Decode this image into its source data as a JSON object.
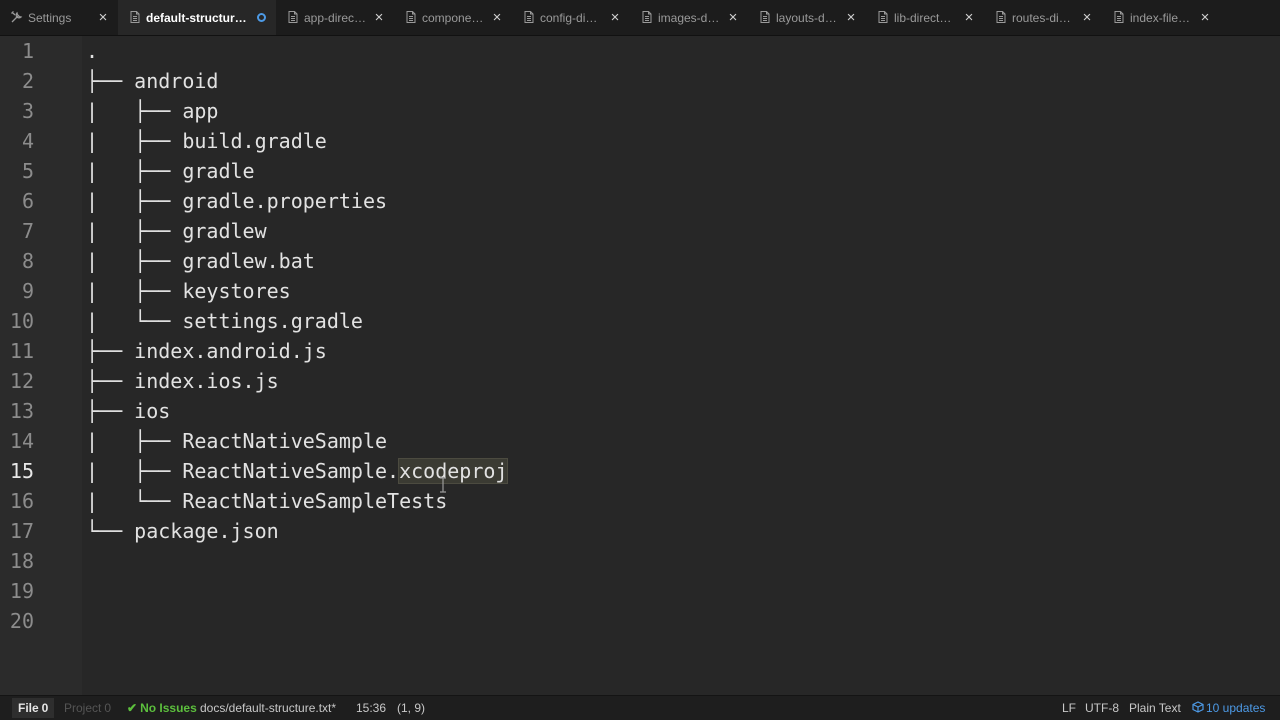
{
  "tabs": [
    {
      "label": "Settings",
      "icon": "settings-icon",
      "active": false,
      "modified": false
    },
    {
      "label": "default-structure.txt",
      "icon": "file-icon",
      "active": true,
      "modified": true
    },
    {
      "label": "app-directory",
      "icon": "file-icon",
      "active": false,
      "modified": false
    },
    {
      "label": "components-directory",
      "icon": "file-icon",
      "active": false,
      "modified": false
    },
    {
      "label": "config-directory",
      "icon": "file-icon",
      "active": false,
      "modified": false
    },
    {
      "label": "images-directory",
      "icon": "file-icon",
      "active": false,
      "modified": false
    },
    {
      "label": "layouts-directory",
      "icon": "file-icon",
      "active": false,
      "modified": false
    },
    {
      "label": "lib-directory",
      "icon": "file-icon",
      "active": false,
      "modified": false
    },
    {
      "label": "routes-directory",
      "icon": "file-icon",
      "active": false,
      "modified": false
    },
    {
      "label": "index-files",
      "icon": "file-icon",
      "active": false,
      "modified": false
    }
  ],
  "tab_display_labels": [
    "Settings",
    "default-structure.txt",
    "app-direc…",
    "compone…",
    "config-di…",
    "images-d…",
    "layouts-d…",
    "lib-direct…",
    "routes-di…",
    "index-file…"
  ],
  "editor": {
    "current_line": 15,
    "lines": [
      {
        "number": "1",
        "text": "."
      },
      {
        "number": "2",
        "text": "├── android"
      },
      {
        "number": "3",
        "text": "|   ├── app"
      },
      {
        "number": "4",
        "text": "|   ├── build.gradle"
      },
      {
        "number": "5",
        "text": "|   ├── gradle"
      },
      {
        "number": "6",
        "text": "|   ├── gradle.properties"
      },
      {
        "number": "7",
        "text": "|   ├── gradlew"
      },
      {
        "number": "8",
        "text": "|   ├── gradlew.bat"
      },
      {
        "number": "9",
        "text": "|   ├── keystores"
      },
      {
        "number": "10",
        "text": "|   └── settings.gradle"
      },
      {
        "number": "11",
        "text": "├── index.android.js"
      },
      {
        "number": "12",
        "text": "├── index.ios.js"
      },
      {
        "number": "13",
        "text": "├── ios"
      },
      {
        "number": "14",
        "text": "|   ├── ReactNativeSample"
      },
      {
        "number": "15",
        "text": "|   ├── ReactNativeSample.",
        "highlight": "xcodeproj"
      },
      {
        "number": "16",
        "text": "|   └── ReactNativeSampleTests"
      },
      {
        "number": "17",
        "text": "└── package.json"
      },
      {
        "number": "18",
        "text": ""
      },
      {
        "number": "19",
        "text": ""
      },
      {
        "number": "20",
        "text": ""
      }
    ]
  },
  "statusbar": {
    "file_label": "File",
    "file_count": "0",
    "project_label": "Project",
    "project_count": "0",
    "issues_label": "No Issues",
    "path": "docs/default-structure.txt*",
    "time": "15:36",
    "cursor_position": "(1, 9)",
    "line_ending": "LF",
    "encoding": "UTF-8",
    "grammar": "Plain Text",
    "updates": "10 updates"
  },
  "colors": {
    "accent": "#4d9ae6",
    "success": "#5cbf3d",
    "background": "#272727"
  }
}
